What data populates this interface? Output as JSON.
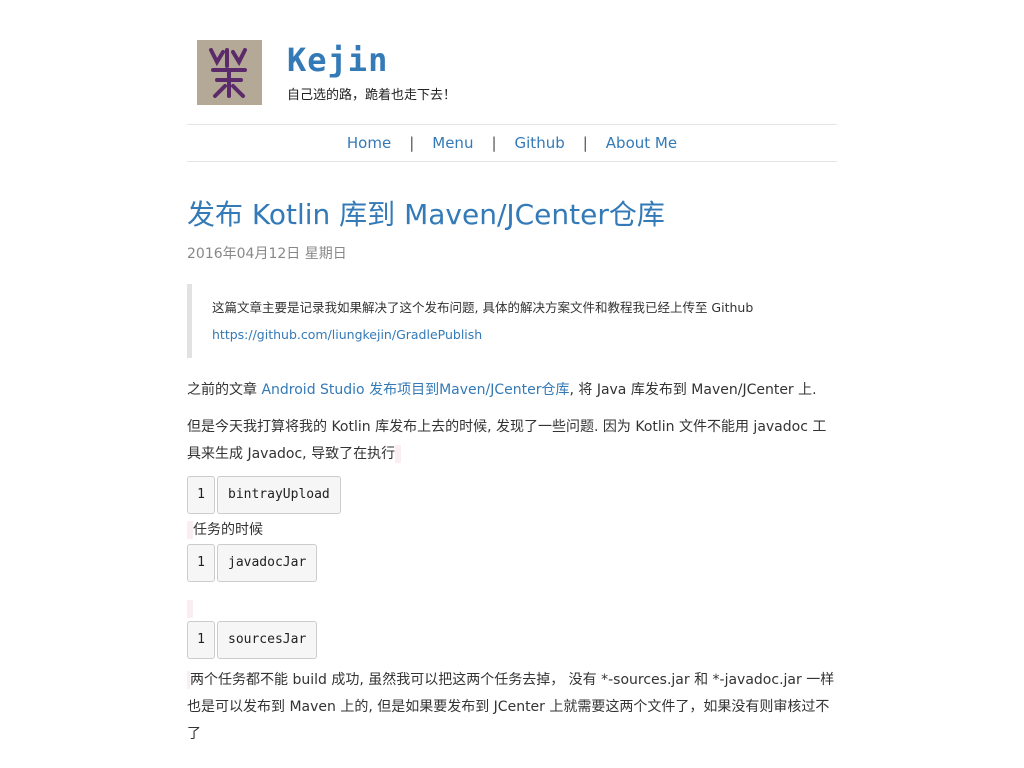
{
  "site": {
    "title": "Kejin",
    "tagline": "自己选的路，跪着也走下去！"
  },
  "nav": {
    "items": [
      {
        "label": "Home"
      },
      {
        "label": "Menu"
      },
      {
        "label": "Github"
      },
      {
        "label": "About Me"
      }
    ],
    "separator": "|"
  },
  "post": {
    "title": "发布 Kotlin 库到 Maven/JCenter仓库",
    "date": "2016年04月12日 星期日",
    "quote_text": "这篇文章主要是记录我如果解决了这个发布问题, 具体的解决方案文件和教程我已经上传至 Github",
    "quote_link": "https://github.com/liungkejin/GradlePublish",
    "p1_prefix": "之前的文章 ",
    "p1_link": "Android Studio 发布项目到Maven/JCenter仓库",
    "p1_suffix": ", 将 Java 库发布到 Maven/JCenter 上.",
    "p2": "但是今天我打算将我的 Kotlin 库发布上去的时候, 发现了一些问题. 因为 Kotlin 文件不能用 javadoc 工具来生成 Javadoc, 导致了在执行",
    "code1": {
      "line": "1",
      "text": "bintrayUpload"
    },
    "between": "任务的时候",
    "code2": {
      "line": "1",
      "text": "javadocJar"
    },
    "code3": {
      "line": "1",
      "text": "sourcesJar"
    },
    "p3": "两个任务都不能 build 成功, 虽然我可以把这两个任务去掉， 没有 *-sources.jar 和 *-javadoc.jar 一样也是可以发布到 Maven 上的, 但是如果要发布到 JCenter 上就需要这两个文件了，如果没有则审核过不了"
  },
  "colors": {
    "link": "#337ab7",
    "date": "#888888",
    "quote_border": "#e2e2e2",
    "code_bg": "#f6f6f6"
  }
}
